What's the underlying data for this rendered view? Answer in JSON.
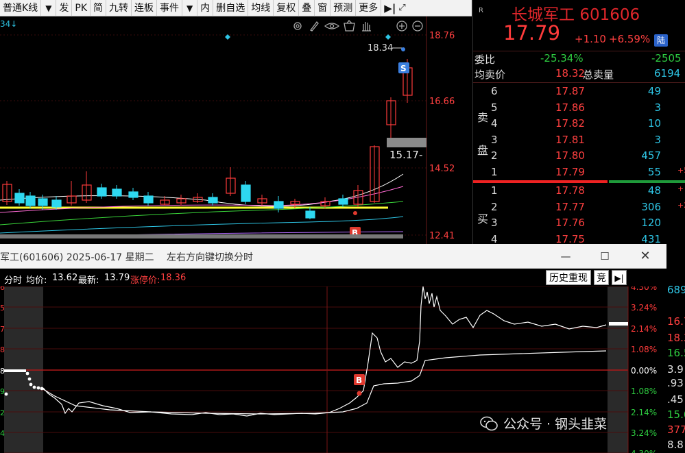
{
  "toolbar": {
    "items": [
      "普通K线",
      "▼",
      "发",
      "PK",
      "简",
      "九转",
      "连板",
      "事件",
      "▼",
      "内",
      "删自选",
      "均线",
      "复权",
      "叠",
      "窗",
      "预测",
      "更多"
    ]
  },
  "kchart": {
    "stub_label": "34↓",
    "price_ticks": [
      "18.76",
      "16.66",
      "14.52",
      "12.41"
    ],
    "tool_icons": [
      "gear-icon",
      "pen-icon",
      "eye-icon",
      "basket-icon",
      "hand-icon",
      "plus-circle-icon",
      "minus-circle-icon"
    ],
    "high_label": "18.34",
    "low_label": "15.17-",
    "s_badge": "S",
    "b_badge": "B",
    "colors": {
      "up": "#ff3b3b",
      "down": "#2ed8f0",
      "ma_yellow": "#ffff33",
      "grid": "#3a0c0c"
    }
  },
  "quote": {
    "r_mark": "R",
    "name": "长城军工",
    "code": "601606",
    "price": "17.79",
    "change": "+1.10",
    "change_pct": "+6.59%",
    "exchange": "陆",
    "weibi_label": "委比",
    "weibi_value": "-25.34%",
    "weibi_diff": "-2505",
    "avg_label": "均卖价",
    "avg_value": "18.32",
    "total_label": "总卖量",
    "total_value": "6194",
    "sell_label_1": "卖",
    "sell_label_2": "盘",
    "buy_label": "买",
    "sells": [
      {
        "level": "6",
        "price": "17.87",
        "vol": "49",
        "tail": ""
      },
      {
        "level": "5",
        "price": "17.86",
        "vol": "3",
        "tail": ""
      },
      {
        "level": "4",
        "price": "17.82",
        "vol": "10",
        "tail": ""
      },
      {
        "level": "3",
        "price": "17.81",
        "vol": "3",
        "tail": ""
      },
      {
        "level": "2",
        "price": "17.80",
        "vol": "457",
        "tail": ""
      },
      {
        "level": "1",
        "price": "17.79",
        "vol": "55",
        "tail": "+5"
      }
    ],
    "buys": [
      {
        "level": "1",
        "price": "17.78",
        "vol": "48",
        "tail": "+"
      },
      {
        "level": "2",
        "price": "17.77",
        "vol": "306",
        "tail": "+2"
      },
      {
        "level": "3",
        "price": "17.76",
        "vol": "120",
        "tail": ""
      },
      {
        "level": "4",
        "price": "17.75",
        "vol": "431",
        "tail": ""
      }
    ],
    "side_values": [
      {
        "text": "689",
        "color": "#2ec6e6"
      },
      {
        "text": "16.7",
        "color": "#ff4040"
      },
      {
        "text": "18.3",
        "color": "#ff4040"
      },
      {
        "text": "16.5",
        "color": "#2ecc40"
      },
      {
        "text": "3.9",
        "color": "#dddddd"
      },
      {
        "text": ".93",
        "color": "#dddddd"
      },
      {
        "text": ".45",
        "color": "#dddddd"
      },
      {
        "text": "15.0",
        "color": "#2ecc40"
      },
      {
        "text": "377",
        "color": "#ff4040"
      },
      {
        "text": "8.8",
        "color": "#dddddd"
      }
    ]
  },
  "popup": {
    "title": "军工(601606) 2025-06-17 星期二",
    "hint": "左右方向键切换分时",
    "minimize": "—",
    "maximize": "☐",
    "close": "✕",
    "info_mode": "分时",
    "info_avg_label": "均价:",
    "info_avg": "13.62",
    "info_latest_label": "最新:",
    "info_latest": "13.79",
    "info_limit_label": "涨停价:",
    "info_limit": "18.36",
    "history_btn": "历史重现",
    "jing_btn": "竞",
    "end_btn": "▶|",
    "pct_ticks": [
      "4.30%",
      "3.24%",
      "2.14%",
      "1.08%",
      "0.00%",
      "1.08%",
      "2.14%",
      "3.24%",
      "4.30%"
    ],
    "left_ticks": [
      "6",
      "5",
      "7",
      "8",
      "8",
      "9",
      "2",
      "4"
    ],
    "b_badge": "B",
    "colors": {
      "up": "#ff3b3b",
      "down": "#2ecc40",
      "flat": "#ffffff",
      "grid": "#5a0d0d"
    }
  },
  "watermark": {
    "text": "公众号 · 钢头韭菜"
  }
}
